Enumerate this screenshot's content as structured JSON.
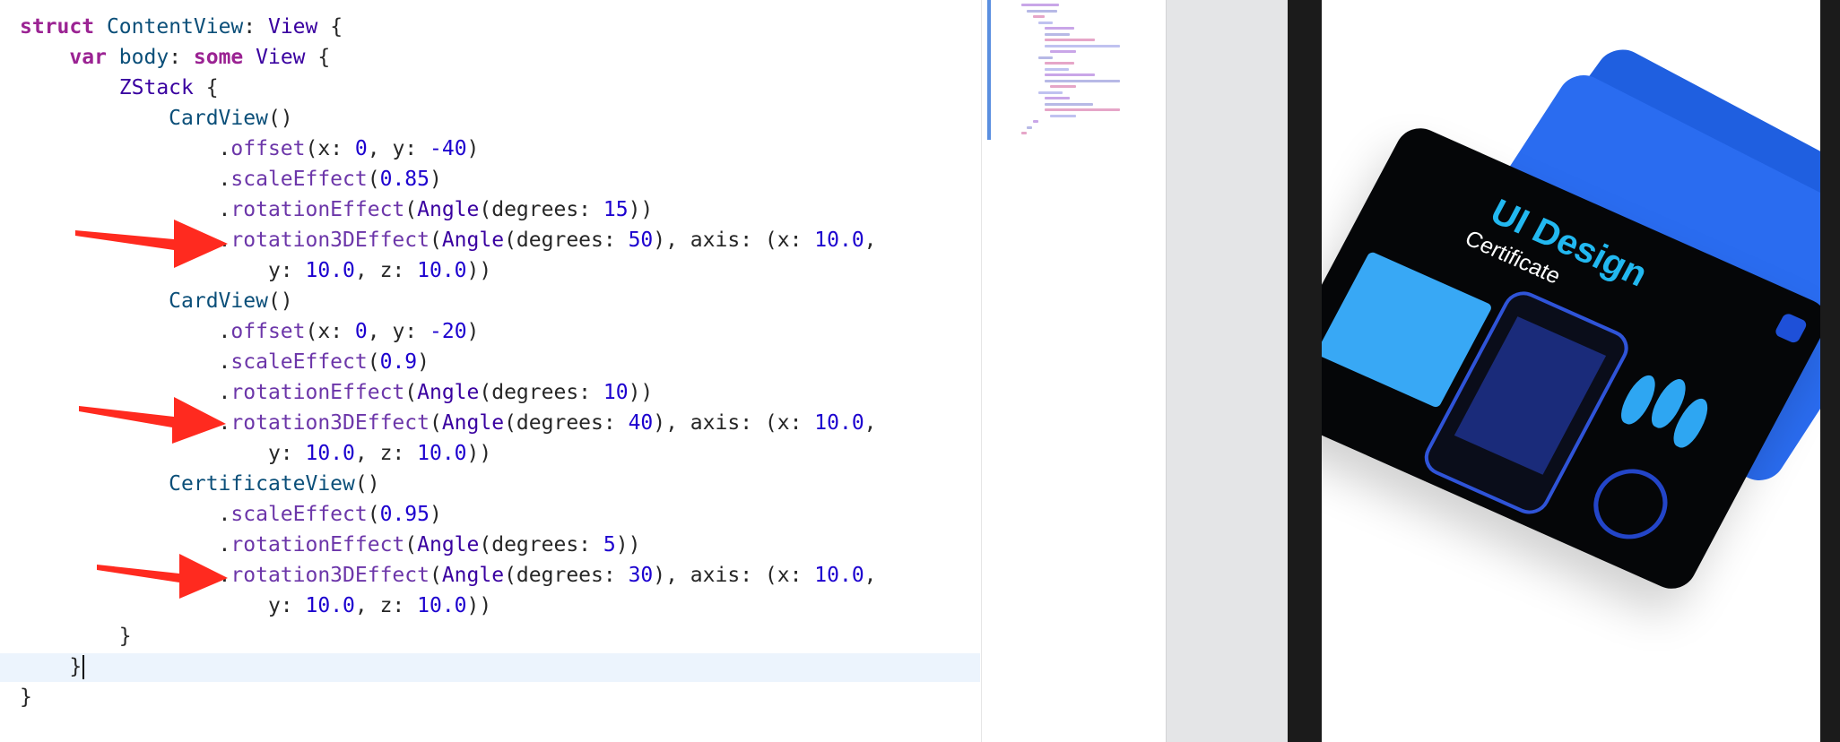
{
  "editor": {
    "lines": [
      [
        [
          "kw",
          "struct"
        ],
        [
          "pr",
          " "
        ],
        [
          "ty",
          "ContentView"
        ],
        [
          "pr",
          ": "
        ],
        [
          "ty2",
          "View"
        ],
        [
          "pr",
          " {"
        ]
      ],
      [
        [
          "pr",
          "    "
        ],
        [
          "kw",
          "var"
        ],
        [
          "pr",
          " "
        ],
        [
          "ty",
          "body"
        ],
        [
          "pr",
          ": "
        ],
        [
          "kw",
          "some"
        ],
        [
          "pr",
          " "
        ],
        [
          "ty2",
          "View"
        ],
        [
          "pr",
          " {"
        ]
      ],
      [
        [
          "pr",
          "        "
        ],
        [
          "ty2",
          "ZStack"
        ],
        [
          "pr",
          " {"
        ]
      ],
      [
        [
          "pr",
          "            "
        ],
        [
          "ty",
          "CardView"
        ],
        [
          "pr",
          "()"
        ]
      ],
      [
        [
          "pr",
          "                ."
        ],
        [
          "mth",
          "offset"
        ],
        [
          "pr",
          "(x: "
        ],
        [
          "num",
          "0"
        ],
        [
          "pr",
          ", y: "
        ],
        [
          "num",
          "-40"
        ],
        [
          "pr",
          ")"
        ]
      ],
      [
        [
          "pr",
          "                ."
        ],
        [
          "mth",
          "scaleEffect"
        ],
        [
          "pr",
          "("
        ],
        [
          "num",
          "0.85"
        ],
        [
          "pr",
          ")"
        ]
      ],
      [
        [
          "pr",
          "                ."
        ],
        [
          "mth",
          "rotationEffect"
        ],
        [
          "pr",
          "("
        ],
        [
          "ty2",
          "Angle"
        ],
        [
          "pr",
          "(degrees: "
        ],
        [
          "num",
          "15"
        ],
        [
          "pr",
          "))"
        ]
      ],
      [
        [
          "pr",
          "                ."
        ],
        [
          "mth",
          "rotation3DEffect"
        ],
        [
          "pr",
          "("
        ],
        [
          "ty2",
          "Angle"
        ],
        [
          "pr",
          "(degrees: "
        ],
        [
          "num",
          "50"
        ],
        [
          "pr",
          "), axis: (x: "
        ],
        [
          "num",
          "10.0"
        ],
        [
          "pr",
          ","
        ]
      ],
      [
        [
          "pr",
          "                    y: "
        ],
        [
          "num",
          "10.0"
        ],
        [
          "pr",
          ", z: "
        ],
        [
          "num",
          "10.0"
        ],
        [
          "pr",
          "))"
        ]
      ],
      [
        [
          "pr",
          "            "
        ],
        [
          "ty",
          "CardView"
        ],
        [
          "pr",
          "()"
        ]
      ],
      [
        [
          "pr",
          "                ."
        ],
        [
          "mth",
          "offset"
        ],
        [
          "pr",
          "(x: "
        ],
        [
          "num",
          "0"
        ],
        [
          "pr",
          ", y: "
        ],
        [
          "num",
          "-20"
        ],
        [
          "pr",
          ")"
        ]
      ],
      [
        [
          "pr",
          "                ."
        ],
        [
          "mth",
          "scaleEffect"
        ],
        [
          "pr",
          "("
        ],
        [
          "num",
          "0.9"
        ],
        [
          "pr",
          ")"
        ]
      ],
      [
        [
          "pr",
          "                ."
        ],
        [
          "mth",
          "rotationEffect"
        ],
        [
          "pr",
          "("
        ],
        [
          "ty2",
          "Angle"
        ],
        [
          "pr",
          "(degrees: "
        ],
        [
          "num",
          "10"
        ],
        [
          "pr",
          "))"
        ]
      ],
      [
        [
          "pr",
          "                ."
        ],
        [
          "mth",
          "rotation3DEffect"
        ],
        [
          "pr",
          "("
        ],
        [
          "ty2",
          "Angle"
        ],
        [
          "pr",
          "(degrees: "
        ],
        [
          "num",
          "40"
        ],
        [
          "pr",
          "), axis: (x: "
        ],
        [
          "num",
          "10.0"
        ],
        [
          "pr",
          ","
        ]
      ],
      [
        [
          "pr",
          "                    y: "
        ],
        [
          "num",
          "10.0"
        ],
        [
          "pr",
          ", z: "
        ],
        [
          "num",
          "10.0"
        ],
        [
          "pr",
          "))"
        ]
      ],
      [
        [
          "pr",
          "            "
        ],
        [
          "ty",
          "CertificateView"
        ],
        [
          "pr",
          "()"
        ]
      ],
      [
        [
          "pr",
          "                ."
        ],
        [
          "mth",
          "scaleEffect"
        ],
        [
          "pr",
          "("
        ],
        [
          "num",
          "0.95"
        ],
        [
          "pr",
          ")"
        ]
      ],
      [
        [
          "pr",
          "                ."
        ],
        [
          "mth",
          "rotationEffect"
        ],
        [
          "pr",
          "("
        ],
        [
          "ty2",
          "Angle"
        ],
        [
          "pr",
          "(degrees: "
        ],
        [
          "num",
          "5"
        ],
        [
          "pr",
          "))"
        ]
      ],
      [
        [
          "pr",
          "                ."
        ],
        [
          "mth",
          "rotation3DEffect"
        ],
        [
          "pr",
          "("
        ],
        [
          "ty2",
          "Angle"
        ],
        [
          "pr",
          "(degrees: "
        ],
        [
          "num",
          "30"
        ],
        [
          "pr",
          "), axis: (x: "
        ],
        [
          "num",
          "10.0"
        ],
        [
          "pr",
          ","
        ]
      ],
      [
        [
          "pr",
          "                    y: "
        ],
        [
          "num",
          "10.0"
        ],
        [
          "pr",
          ", z: "
        ],
        [
          "num",
          "10.0"
        ],
        [
          "pr",
          "))"
        ]
      ],
      [
        [
          "pr",
          "        }"
        ]
      ],
      [
        [
          "pr",
          "    }"
        ]
      ],
      [
        [
          "pr",
          "}"
        ]
      ]
    ],
    "caret_line": 21,
    "arrow_color": "#ff2a1f"
  },
  "preview": {
    "certificate_title": "UI Design",
    "certificate_subtitle": "Certificate",
    "accent": "#22b8f0",
    "card_blue": "#2a6cf0"
  }
}
